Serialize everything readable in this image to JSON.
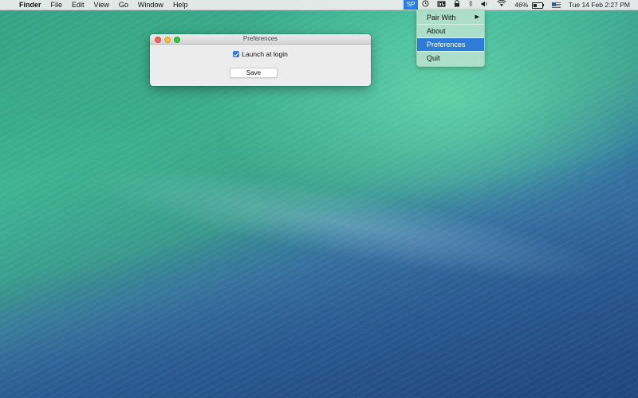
{
  "menubar": {
    "apple_icon": "",
    "app_name": "Finder",
    "items": [
      "File",
      "Edit",
      "View",
      "Go",
      "Window",
      "Help"
    ],
    "status": {
      "sp_label": "SP",
      "battery_percent_text": "46%",
      "battery_level": 0.46,
      "datetime": "Tue 14 Feb  2:27 PM"
    }
  },
  "dropdown": {
    "items": [
      {
        "label": "Pair With",
        "has_submenu": true
      },
      {
        "label": "About"
      },
      {
        "label": "Preferences",
        "selected": true
      },
      {
        "label": "Quit"
      }
    ]
  },
  "prefs_window": {
    "title": "Preferences",
    "launch_at_login_label": "Launch at login",
    "launch_at_login_checked": true,
    "save_label": "Save"
  },
  "icons": {
    "sp_status": "sp-icon",
    "clock_status": "clock-icon",
    "cpu_status": "cpu-icon",
    "lock_status": "lock-icon",
    "bluetooth_status": "bluetooth-icon",
    "volume_status": "speaker-icon",
    "wifi_status": "wifi-icon",
    "battery_status": "battery-icon",
    "input_source": "us-flag-icon"
  },
  "colors": {
    "selection": "#2e7bd9",
    "sp_highlight": "#2a7de1",
    "dropdown_bg": "#b4e1cd"
  }
}
